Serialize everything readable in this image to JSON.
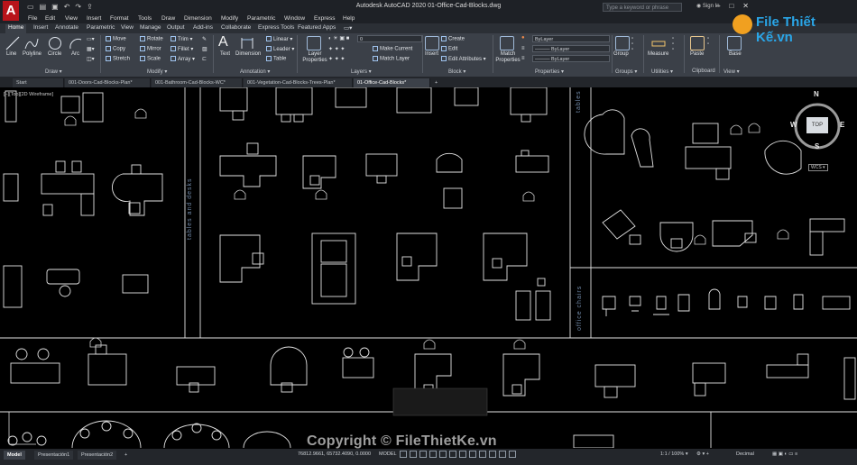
{
  "app": {
    "logo_letter": "A",
    "title": "Autodesk AutoCAD 2020   01-Office-Cad-Blocks.dwg",
    "search_placeholder": "Type a keyword or phrase",
    "sign_in": "Sign In"
  },
  "menu": [
    "File",
    "Edit",
    "View",
    "Insert",
    "Format",
    "Tools",
    "Draw",
    "Dimension",
    "Modify",
    "Parametric",
    "Window",
    "Express",
    "Help"
  ],
  "ribbon_tabs": [
    "Home",
    "Insert",
    "Annotate",
    "Parametric",
    "View",
    "Manage",
    "Output",
    "Add-ins",
    "Collaborate",
    "Express Tools",
    "Featured Apps"
  ],
  "ribbon": {
    "draw": {
      "title": "Draw ▾",
      "line": "Line",
      "polyline": "Polyline",
      "circle": "Circle",
      "arc": "Arc"
    },
    "modify": {
      "title": "Modify ▾",
      "move": "Move",
      "rotate": "Rotate",
      "trim": "Trim ▾",
      "copy": "Copy",
      "mirror": "Mirror",
      "fillet": "Fillet ▾",
      "stretch": "Stretch",
      "scale": "Scale",
      "array": "Array ▾"
    },
    "annotation": {
      "title": "Annotation ▾",
      "text": "Text",
      "dimension": "Dimension",
      "linear": "Linear ▾",
      "leader": "Leader ▾",
      "table": "Table"
    },
    "layers": {
      "title": "Layers ▾",
      "layer_properties": "Layer Properties",
      "layer_value": "0",
      "make_current": "Make Current",
      "match_layer": "Match Layer"
    },
    "block": {
      "title": "Block ▾",
      "insert": "Insert",
      "create": "Create",
      "edit": "Edit",
      "edit_attributes": "Edit Attributes ▾"
    },
    "properties": {
      "title": "Properties ▾",
      "match": "Match Properties",
      "bylayer1": "ByLayer",
      "bylayer2": "——— ByLayer",
      "bylayer3": "——— ByLayer"
    },
    "groups": {
      "title": "Groups ▾",
      "group": "Group"
    },
    "utilities": {
      "title": "Utilities ▾",
      "measure": "Measure"
    },
    "clipboard": {
      "title": "Clipboard",
      "paste": "Paste"
    },
    "view": {
      "title": "View ▾",
      "base": "Base"
    }
  },
  "doc_tabs": [
    "Start",
    "001-Doors-Cad-Blocks-Plan*",
    "001-Bathroom-Cad-Blocks-WC*",
    "001-Vegetation-Cad-Blocks-Trees-Plan*",
    "01-Office-Cad-Blocks*"
  ],
  "viewport_label": "[–][Top][2D Wireframe]",
  "drawing_labels": {
    "tables_and_desks": "tables and desks",
    "tables": "tables",
    "office_chairs": "office chairs"
  },
  "viewcube": {
    "top": "TOP",
    "n": "N",
    "s": "S",
    "e": "E",
    "w": "W",
    "wcs": "WCS ▾"
  },
  "layout_tabs": [
    "Model",
    "Presentación1",
    "Presentación2"
  ],
  "status": {
    "coords": "76812.9661, 65732.4090, 0.0000",
    "model": "MODEL",
    "scale": "1:1 / 100% ▾",
    "units": "Decimal"
  },
  "watermark": "Copyright © FileThietKe.vn",
  "brand_logo": "File Thiết Kế.vn",
  "colors": {
    "accent": "#b8141a",
    "ribbon": "#3b4048",
    "canvas": "#000000",
    "lines": "#e6e6e6"
  }
}
